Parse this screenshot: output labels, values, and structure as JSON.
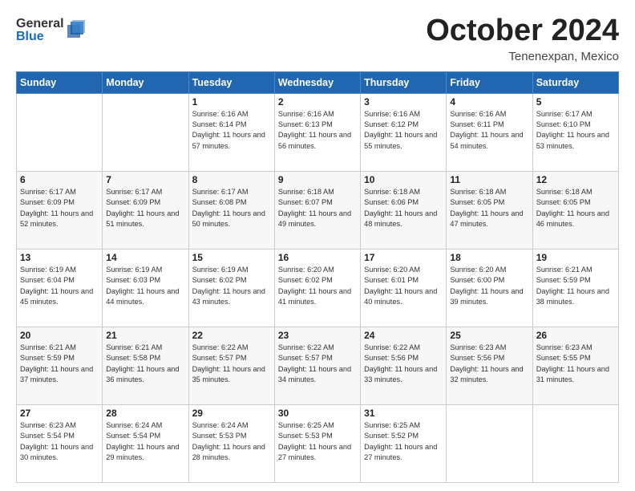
{
  "header": {
    "logo_general": "General",
    "logo_blue": "Blue",
    "month": "October 2024",
    "location": "Tenenexpan, Mexico"
  },
  "days_of_week": [
    "Sunday",
    "Monday",
    "Tuesday",
    "Wednesday",
    "Thursday",
    "Friday",
    "Saturday"
  ],
  "weeks": [
    [
      {
        "day": "",
        "info": ""
      },
      {
        "day": "",
        "info": ""
      },
      {
        "day": "1",
        "info": "Sunrise: 6:16 AM\nSunset: 6:14 PM\nDaylight: 11 hours and 57 minutes."
      },
      {
        "day": "2",
        "info": "Sunrise: 6:16 AM\nSunset: 6:13 PM\nDaylight: 11 hours and 56 minutes."
      },
      {
        "day": "3",
        "info": "Sunrise: 6:16 AM\nSunset: 6:12 PM\nDaylight: 11 hours and 55 minutes."
      },
      {
        "day": "4",
        "info": "Sunrise: 6:16 AM\nSunset: 6:11 PM\nDaylight: 11 hours and 54 minutes."
      },
      {
        "day": "5",
        "info": "Sunrise: 6:17 AM\nSunset: 6:10 PM\nDaylight: 11 hours and 53 minutes."
      }
    ],
    [
      {
        "day": "6",
        "info": "Sunrise: 6:17 AM\nSunset: 6:09 PM\nDaylight: 11 hours and 52 minutes."
      },
      {
        "day": "7",
        "info": "Sunrise: 6:17 AM\nSunset: 6:09 PM\nDaylight: 11 hours and 51 minutes."
      },
      {
        "day": "8",
        "info": "Sunrise: 6:17 AM\nSunset: 6:08 PM\nDaylight: 11 hours and 50 minutes."
      },
      {
        "day": "9",
        "info": "Sunrise: 6:18 AM\nSunset: 6:07 PM\nDaylight: 11 hours and 49 minutes."
      },
      {
        "day": "10",
        "info": "Sunrise: 6:18 AM\nSunset: 6:06 PM\nDaylight: 11 hours and 48 minutes."
      },
      {
        "day": "11",
        "info": "Sunrise: 6:18 AM\nSunset: 6:05 PM\nDaylight: 11 hours and 47 minutes."
      },
      {
        "day": "12",
        "info": "Sunrise: 6:18 AM\nSunset: 6:05 PM\nDaylight: 11 hours and 46 minutes."
      }
    ],
    [
      {
        "day": "13",
        "info": "Sunrise: 6:19 AM\nSunset: 6:04 PM\nDaylight: 11 hours and 45 minutes."
      },
      {
        "day": "14",
        "info": "Sunrise: 6:19 AM\nSunset: 6:03 PM\nDaylight: 11 hours and 44 minutes."
      },
      {
        "day": "15",
        "info": "Sunrise: 6:19 AM\nSunset: 6:02 PM\nDaylight: 11 hours and 43 minutes."
      },
      {
        "day": "16",
        "info": "Sunrise: 6:20 AM\nSunset: 6:02 PM\nDaylight: 11 hours and 41 minutes."
      },
      {
        "day": "17",
        "info": "Sunrise: 6:20 AM\nSunset: 6:01 PM\nDaylight: 11 hours and 40 minutes."
      },
      {
        "day": "18",
        "info": "Sunrise: 6:20 AM\nSunset: 6:00 PM\nDaylight: 11 hours and 39 minutes."
      },
      {
        "day": "19",
        "info": "Sunrise: 6:21 AM\nSunset: 5:59 PM\nDaylight: 11 hours and 38 minutes."
      }
    ],
    [
      {
        "day": "20",
        "info": "Sunrise: 6:21 AM\nSunset: 5:59 PM\nDaylight: 11 hours and 37 minutes."
      },
      {
        "day": "21",
        "info": "Sunrise: 6:21 AM\nSunset: 5:58 PM\nDaylight: 11 hours and 36 minutes."
      },
      {
        "day": "22",
        "info": "Sunrise: 6:22 AM\nSunset: 5:57 PM\nDaylight: 11 hours and 35 minutes."
      },
      {
        "day": "23",
        "info": "Sunrise: 6:22 AM\nSunset: 5:57 PM\nDaylight: 11 hours and 34 minutes."
      },
      {
        "day": "24",
        "info": "Sunrise: 6:22 AM\nSunset: 5:56 PM\nDaylight: 11 hours and 33 minutes."
      },
      {
        "day": "25",
        "info": "Sunrise: 6:23 AM\nSunset: 5:56 PM\nDaylight: 11 hours and 32 minutes."
      },
      {
        "day": "26",
        "info": "Sunrise: 6:23 AM\nSunset: 5:55 PM\nDaylight: 11 hours and 31 minutes."
      }
    ],
    [
      {
        "day": "27",
        "info": "Sunrise: 6:23 AM\nSunset: 5:54 PM\nDaylight: 11 hours and 30 minutes."
      },
      {
        "day": "28",
        "info": "Sunrise: 6:24 AM\nSunset: 5:54 PM\nDaylight: 11 hours and 29 minutes."
      },
      {
        "day": "29",
        "info": "Sunrise: 6:24 AM\nSunset: 5:53 PM\nDaylight: 11 hours and 28 minutes."
      },
      {
        "day": "30",
        "info": "Sunrise: 6:25 AM\nSunset: 5:53 PM\nDaylight: 11 hours and 27 minutes."
      },
      {
        "day": "31",
        "info": "Sunrise: 6:25 AM\nSunset: 5:52 PM\nDaylight: 11 hours and 27 minutes."
      },
      {
        "day": "",
        "info": ""
      },
      {
        "day": "",
        "info": ""
      }
    ]
  ]
}
